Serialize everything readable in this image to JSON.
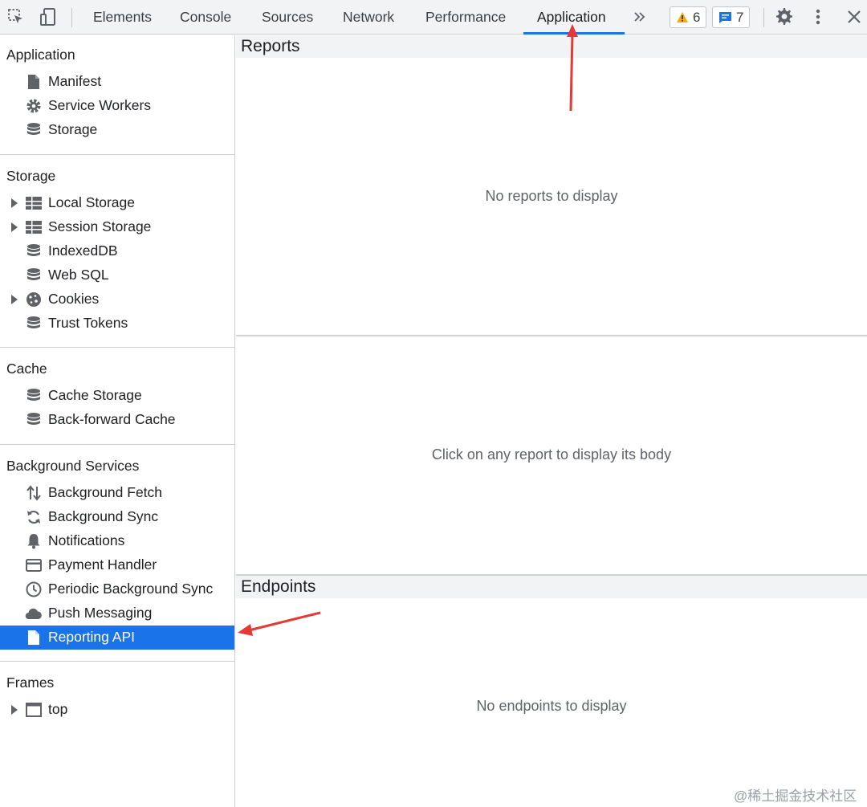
{
  "toolbar": {
    "tabs": [
      {
        "label": "Elements"
      },
      {
        "label": "Console"
      },
      {
        "label": "Sources"
      },
      {
        "label": "Network"
      },
      {
        "label": "Performance"
      },
      {
        "label": "Application"
      }
    ],
    "active_tab": "Application",
    "more_tabs_icon": "chevron-double-right",
    "warnings_count": "6",
    "messages_count": "7",
    "accent_color": "#1a73e8",
    "warning_color": "#f9ab00"
  },
  "sidebar": {
    "sections": [
      {
        "title": "Application",
        "items": [
          {
            "label": "Manifest",
            "icon": "document-icon"
          },
          {
            "label": "Service Workers",
            "icon": "gear-icon"
          },
          {
            "label": "Storage",
            "icon": "database-icon"
          }
        ]
      },
      {
        "title": "Storage",
        "items": [
          {
            "label": "Local Storage",
            "icon": "grid-icon",
            "expandable": true
          },
          {
            "label": "Session Storage",
            "icon": "grid-icon",
            "expandable": true
          },
          {
            "label": "IndexedDB",
            "icon": "database-icon"
          },
          {
            "label": "Web SQL",
            "icon": "database-icon"
          },
          {
            "label": "Cookies",
            "icon": "cookie-icon",
            "expandable": true
          },
          {
            "label": "Trust Tokens",
            "icon": "database-icon"
          }
        ]
      },
      {
        "title": "Cache",
        "items": [
          {
            "label": "Cache Storage",
            "icon": "database-icon"
          },
          {
            "label": "Back-forward Cache",
            "icon": "database-icon"
          }
        ]
      },
      {
        "title": "Background Services",
        "items": [
          {
            "label": "Background Fetch",
            "icon": "up-down-arrows-icon"
          },
          {
            "label": "Background Sync",
            "icon": "sync-icon"
          },
          {
            "label": "Notifications",
            "icon": "bell-icon"
          },
          {
            "label": "Payment Handler",
            "icon": "card-icon"
          },
          {
            "label": "Periodic Background Sync",
            "icon": "clock-icon"
          },
          {
            "label": "Push Messaging",
            "icon": "cloud-icon"
          },
          {
            "label": "Reporting API",
            "icon": "document-icon",
            "selected": true
          }
        ]
      },
      {
        "title": "Frames",
        "items": [
          {
            "label": "top",
            "icon": "frame-icon",
            "expandable": true
          }
        ]
      }
    ]
  },
  "main": {
    "reports_header": "Reports",
    "reports_empty": "No reports to display",
    "report_body_hint": "Click on any report to display its body",
    "endpoints_header": "Endpoints",
    "endpoints_empty": "No endpoints to display"
  },
  "watermark": "@稀土掘金技术社区"
}
